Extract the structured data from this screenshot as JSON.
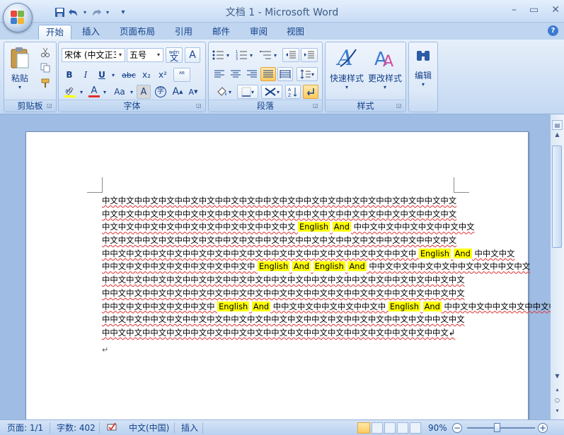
{
  "window": {
    "title": "文档 1 - Microsoft Word",
    "minimize": "–",
    "restore": "▭",
    "close": "✕"
  },
  "qat": {
    "save_icon": "save-icon",
    "undo_icon": "undo-icon",
    "redo_icon": "redo-icon",
    "customize": "▾"
  },
  "tabs": [
    {
      "label": "开始",
      "active": true
    },
    {
      "label": "插入"
    },
    {
      "label": "页面布局"
    },
    {
      "label": "引用"
    },
    {
      "label": "邮件"
    },
    {
      "label": "审阅"
    },
    {
      "label": "视图"
    }
  ],
  "ribbon": {
    "clipboard": {
      "label": "剪贴板",
      "paste": "粘贴"
    },
    "font": {
      "label": "字体",
      "font_name": "宋体 (中文正3",
      "font_size": "五号",
      "phonetic": "wén\n文",
      "bold": "B",
      "italic": "I",
      "underline": "U",
      "strike": "abc",
      "subscript": "x₂",
      "superscript": "x²",
      "grow": "A",
      "shrink": "A",
      "change_case": "Aa",
      "char_border": "A",
      "enclose": "字"
    },
    "paragraph": {
      "label": "段落"
    },
    "styles": {
      "label": "样式",
      "quick": "快速样式",
      "change": "更改样式"
    },
    "editing": {
      "label": "编辑"
    }
  },
  "document": {
    "lines": [
      [
        {
          "t": "中文中文中中文中文中中文中文中中文中文中中文中文中中文中文中中文中文中中文中文中中文中文"
        }
      ],
      [
        {
          "t": "中文中文中中文中文中中文中文中中文中文中中文中文中中文中文中中文中文中中文中文中中文中文"
        }
      ],
      [
        {
          "t": "中文中文中中文中文中中文中文中中文中文中中文中文 "
        },
        {
          "t": "English",
          "h": true
        },
        {
          "t": " "
        },
        {
          "t": "And",
          "h": true
        },
        {
          "t": " 中中文中文中中文中文中中文中文"
        }
      ],
      [
        {
          "t": "中文中文中中文中文中中文中文中中文中文中中文中文中中文中文中中文中文中中文中文中中文中文"
        }
      ],
      [
        {
          "t": "中中文中文中中文中文中中文中文中中文中文中中文中文中中文中文中中文中文中中文中 "
        },
        {
          "t": "English",
          "h": true
        },
        {
          "t": " "
        },
        {
          "t": "And",
          "h": true
        },
        {
          "t": " 中中文中文"
        }
      ],
      [
        {
          "t": "中中文中文中中文中文中中文中文中中文中 "
        },
        {
          "t": "English",
          "h": true
        },
        {
          "t": " "
        },
        {
          "t": "And",
          "h": true
        },
        {
          "t": " "
        },
        {
          "t": "English",
          "h": true
        },
        {
          "t": " "
        },
        {
          "t": "And",
          "h": true
        },
        {
          "t": " 中中文中文中中文中文中中文中文中中文中文"
        }
      ],
      [
        {
          "t": "中中文中文中中文中文中中文中文中中文中文中中文中文中中文中文中中文中文中中文中文中中文中文"
        }
      ],
      [
        {
          "t": "中中文中文中中文中文中中文中文中中文中文中中文中文中中文中文中中文中文中中文中文中中文中文"
        }
      ],
      [
        {
          "t": "中中文中文中中文中文中中文中 "
        },
        {
          "t": "English",
          "h": true
        },
        {
          "t": " "
        },
        {
          "t": "And",
          "h": true
        },
        {
          "t": " 中中文中文中中文中文中中文中 "
        },
        {
          "t": "English",
          "h": true
        },
        {
          "t": " "
        },
        {
          "t": "And",
          "h": true
        },
        {
          "t": " 中中文中文中中文中文中中文中文"
        }
      ],
      [
        {
          "t": "中中文中文中中文中文中中文中文中中文中文中中文中文中中文中文中中文中文中中文中文中中文中文"
        }
      ],
      [
        {
          "t": "中中文中文中中文中文中中文中文中中文中文中中文中文中中文中文中中文中文中中文中文中中文↲"
        }
      ]
    ],
    "paragraph_mark": "↵",
    "highlight_color": "#ffff00"
  },
  "status": {
    "page": "页面: 1/1",
    "words": "字数: 402",
    "language": "中文(中国)",
    "mode": "插入",
    "zoom": "90%",
    "zoom_minus": "−",
    "zoom_plus": "+",
    "zoom_level": 0.9
  }
}
